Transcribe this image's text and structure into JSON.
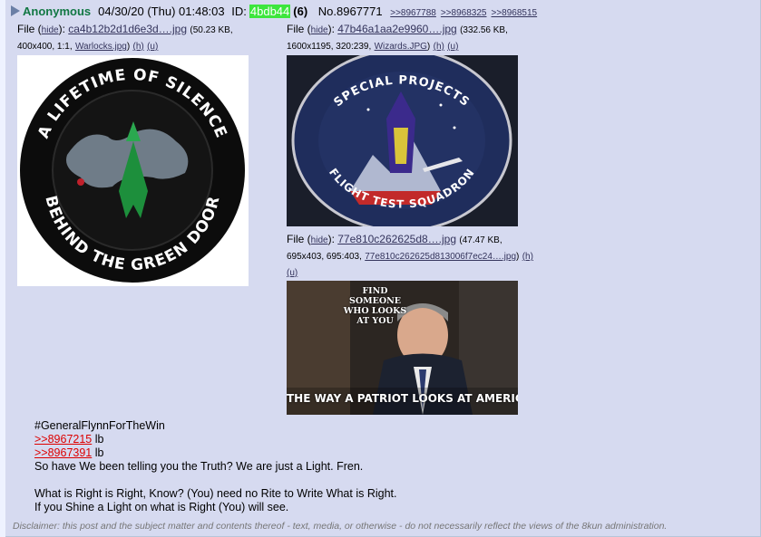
{
  "post": {
    "name": "Anonymous",
    "date": "04/30/20 (Thu) 01:48:03",
    "id_label": "ID:",
    "poster_id": "4bdb44",
    "id_count": "(6)",
    "post_no": "No.8967771",
    "backlinks": [
      ">>8967788",
      ">>8968325",
      ">>8968515"
    ]
  },
  "files": [
    {
      "prefix": "File (",
      "hide": "hide",
      "mid": "): ",
      "filename": "ca4b12b2d1d6e3d….jpg",
      "size": "(50.23 KB,",
      "dims": "400x400, 1:1,",
      "orig": "Warlocks.jpg",
      "h": "(h)",
      "u": "(u)",
      "patch_top": "A LIFETIME OF SILENCE",
      "patch_bottom": "BEHIND THE GREEN DOOR"
    },
    {
      "prefix": "File (",
      "hide": "hide",
      "mid": "): ",
      "filename": "47b46a1aa2e9960….jpg",
      "size": "(332.56 KB,",
      "dims": "1600x1195, 320:239,",
      "orig": "Wizards.JPG",
      "h": "(h)",
      "u": "(u)",
      "patch_top": "SPECIAL PROJECTS",
      "patch_bottom": "FLIGHT TEST SQUADRON"
    },
    {
      "prefix": "File (",
      "hide": "hide",
      "mid": "): ",
      "filename": "77e810c262625d8….jpg",
      "size": "(47.47 KB,",
      "dims": "695x403, 695:403,",
      "orig": "77e810c262625d813006f7ec24….jpg",
      "h": "(h)",
      "u": "(u)",
      "meme_top": "FIND SOMEONE WHO LOOKS AT YOU",
      "meme_bottom": "THE WAY A PATRIOT LOOKS AT AMERICA"
    }
  ],
  "body": {
    "line1": "#GeneralFlynnForTheWin",
    "quote1": ">>8967215",
    "quote1_suffix": " lb",
    "quote2": ">>8967391",
    "quote2_suffix": " lb",
    "line4": "So have We been telling you the Truth? We are just a Light. Fren.",
    "line6": "What is Right is Right, Know? (You) need no Rite to Write What is Right.",
    "line7": "If you Shine a Light on what is Right (You) will see."
  },
  "disclaimer": "Disclaimer: this post and the subject matter and contents thereof - text, media, or otherwise - do not necessarily reflect the views of the 8kun administration.",
  "colors": {
    "name": "#117743",
    "poster_id_bg": "#3de63d",
    "quote_link": "#dd0000",
    "post_bg": "#d6daf0"
  }
}
